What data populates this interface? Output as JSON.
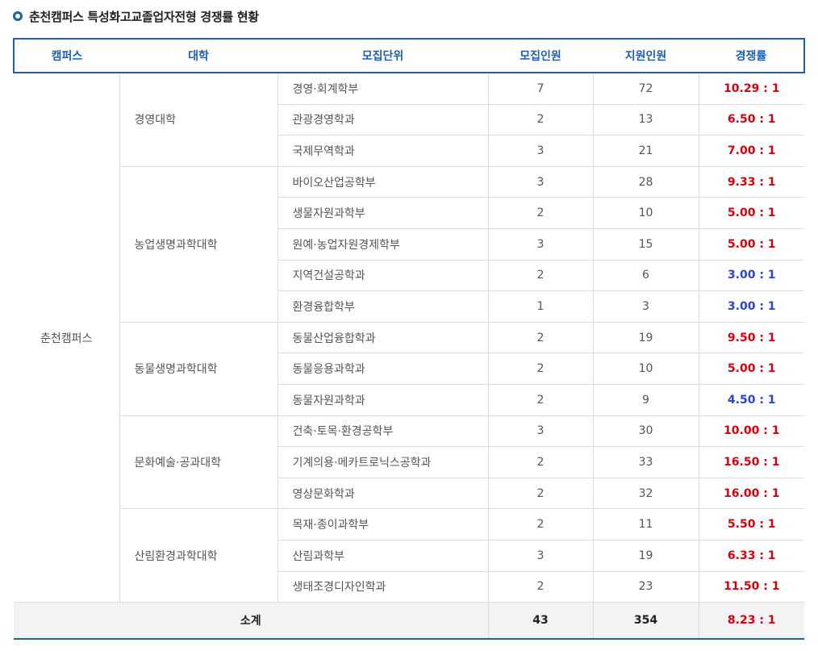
{
  "title": "춘천캠퍼스 특성화고교졸업자전형 경쟁률 현황",
  "colors": {
    "accent": "#1e5fae",
    "high": "#d7000f",
    "low": "#2a45d6"
  },
  "headers": [
    "캠퍼스",
    "대학",
    "모집단위",
    "모집인원",
    "지원인원",
    "경쟁률"
  ],
  "campus": "춘천캠퍼스",
  "colleges": [
    {
      "name": "경영대학",
      "units": [
        {
          "name": "경영·회계학부",
          "quota": "7",
          "applicants": "72",
          "rate": "10.29 : 1",
          "tone": "high"
        },
        {
          "name": "관광경영학과",
          "quota": "2",
          "applicants": "13",
          "rate": "6.50 : 1",
          "tone": "high"
        },
        {
          "name": "국제무역학과",
          "quota": "3",
          "applicants": "21",
          "rate": "7.00 : 1",
          "tone": "high"
        }
      ]
    },
    {
      "name": "농업생명과학대학",
      "units": [
        {
          "name": "바이오산업공학부",
          "quota": "3",
          "applicants": "28",
          "rate": "9.33 : 1",
          "tone": "high"
        },
        {
          "name": "생물자원과학부",
          "quota": "2",
          "applicants": "10",
          "rate": "5.00 : 1",
          "tone": "high"
        },
        {
          "name": "원예·농업자원경제학부",
          "quota": "3",
          "applicants": "15",
          "rate": "5.00 : 1",
          "tone": "high"
        },
        {
          "name": "지역건설공학과",
          "quota": "2",
          "applicants": "6",
          "rate": "3.00 : 1",
          "tone": "low"
        },
        {
          "name": "환경융합학부",
          "quota": "1",
          "applicants": "3",
          "rate": "3.00 : 1",
          "tone": "low"
        }
      ]
    },
    {
      "name": "동물생명과학대학",
      "units": [
        {
          "name": "동물산업융합학과",
          "quota": "2",
          "applicants": "19",
          "rate": "9.50 : 1",
          "tone": "high"
        },
        {
          "name": "동물응용과학과",
          "quota": "2",
          "applicants": "10",
          "rate": "5.00 : 1",
          "tone": "high"
        },
        {
          "name": "동물자원과학과",
          "quota": "2",
          "applicants": "9",
          "rate": "4.50 : 1",
          "tone": "low"
        }
      ]
    },
    {
      "name": "문화예술·공과대학",
      "units": [
        {
          "name": "건축·토목·환경공학부",
          "quota": "3",
          "applicants": "30",
          "rate": "10.00 : 1",
          "tone": "high"
        },
        {
          "name": "기계의용·메카트로닉스공학과",
          "quota": "2",
          "applicants": "33",
          "rate": "16.50 : 1",
          "tone": "high"
        },
        {
          "name": "영상문화학과",
          "quota": "2",
          "applicants": "32",
          "rate": "16.00 : 1",
          "tone": "high"
        }
      ]
    },
    {
      "name": "산림환경과학대학",
      "units": [
        {
          "name": "목재·종이과학부",
          "quota": "2",
          "applicants": "11",
          "rate": "5.50 : 1",
          "tone": "high"
        },
        {
          "name": "산림과학부",
          "quota": "3",
          "applicants": "19",
          "rate": "6.33 : 1",
          "tone": "high"
        },
        {
          "name": "생태조경디자인학과",
          "quota": "2",
          "applicants": "23",
          "rate": "11.50 : 1",
          "tone": "high"
        }
      ]
    }
  ],
  "total": {
    "label": "소계",
    "quota": "43",
    "applicants": "354",
    "rate": "8.23 : 1",
    "tone": "high"
  }
}
